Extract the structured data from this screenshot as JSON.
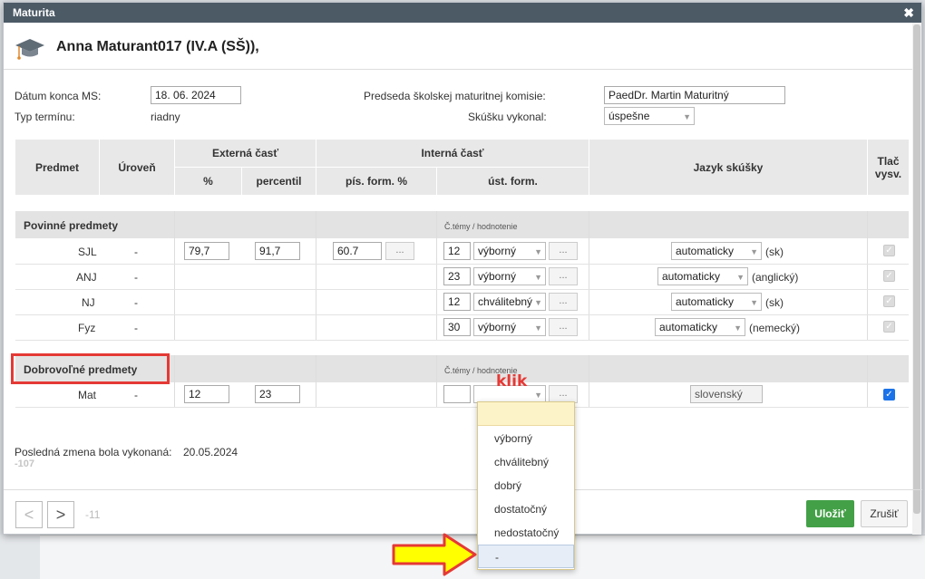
{
  "window": {
    "title": "Maturita",
    "close": "✖"
  },
  "student": {
    "name": "Anna Maturant017 (IV.A (SŠ)),"
  },
  "form": {
    "end_date_label": "Dátum konca MS:",
    "end_date_value": "18. 06. 2024",
    "term_type_label": "Typ termínu:",
    "term_type_value": "riadny",
    "chair_label": "Predseda školskej maturitnej komisie:",
    "chair_value": "PaedDr. Martin Maturitný",
    "passed_label": "Skúšku vykonal:",
    "passed_value": "úspešne"
  },
  "table": {
    "headers": {
      "subject": "Predmet",
      "level": "Úroveň",
      "external": "Externá časť",
      "percent": "%",
      "percentile": "percentil",
      "internal": "Interná časť",
      "written": "pís. form. %",
      "oral": "úst. form.",
      "language": "Jazyk skúšky",
      "print": "Tlač vysv."
    },
    "mandatory": {
      "title": "Povinné predmety",
      "topic_label": "Č.témy / hodnotenie",
      "rows": [
        {
          "subject": "SJL",
          "level": "-",
          "pct": "79,7",
          "percentile": "91,7",
          "written": "60.7",
          "topic": "12",
          "grade": "výborný",
          "lang": "automaticky",
          "lang_note": "(sk)"
        },
        {
          "subject": "ANJ",
          "level": "-",
          "pct": "",
          "percentile": "",
          "written": "",
          "topic": "23",
          "grade": "výborný",
          "lang": "automaticky",
          "lang_note": "(anglický)"
        },
        {
          "subject": "NJ",
          "level": "-",
          "pct": "",
          "percentile": "",
          "written": "",
          "topic": "12",
          "grade": "chválitebný",
          "lang": "automaticky",
          "lang_note": "(sk)"
        },
        {
          "subject": "Fyz",
          "level": "-",
          "pct": "",
          "percentile": "",
          "written": "",
          "topic": "30",
          "grade": "výborný",
          "lang": "automaticky",
          "lang_note": "(nemecký)"
        }
      ]
    },
    "voluntary": {
      "title": "Dobrovoľné predmety",
      "topic_label": "Č.témy / hodnotenie",
      "rows": [
        {
          "subject": "Mat",
          "level": "-",
          "pct": "12",
          "percentile": "23",
          "topic": "",
          "grade": "",
          "lang": "slovenský"
        }
      ]
    },
    "dots": "..."
  },
  "last_change": {
    "label": "Posledná zmena bola vykonaná:",
    "value": "20.05.2024",
    "code": "-107"
  },
  "footer": {
    "prev": "<",
    "next": ">",
    "counter": "-11",
    "save": "Uložiť",
    "cancel": "Zrušiť"
  },
  "dropdown": {
    "options": [
      "",
      "výborný",
      "chválitebný",
      "dobrý",
      "dostatočný",
      "nedostatočný",
      "-"
    ]
  },
  "annotations": {
    "klik": "klik"
  },
  "colors": {
    "titlebar": "#4c5a66",
    "save": "#43a047",
    "annotation": "#e53935",
    "arrow": "#ffff00",
    "checkbox_on": "#1a73e8"
  }
}
